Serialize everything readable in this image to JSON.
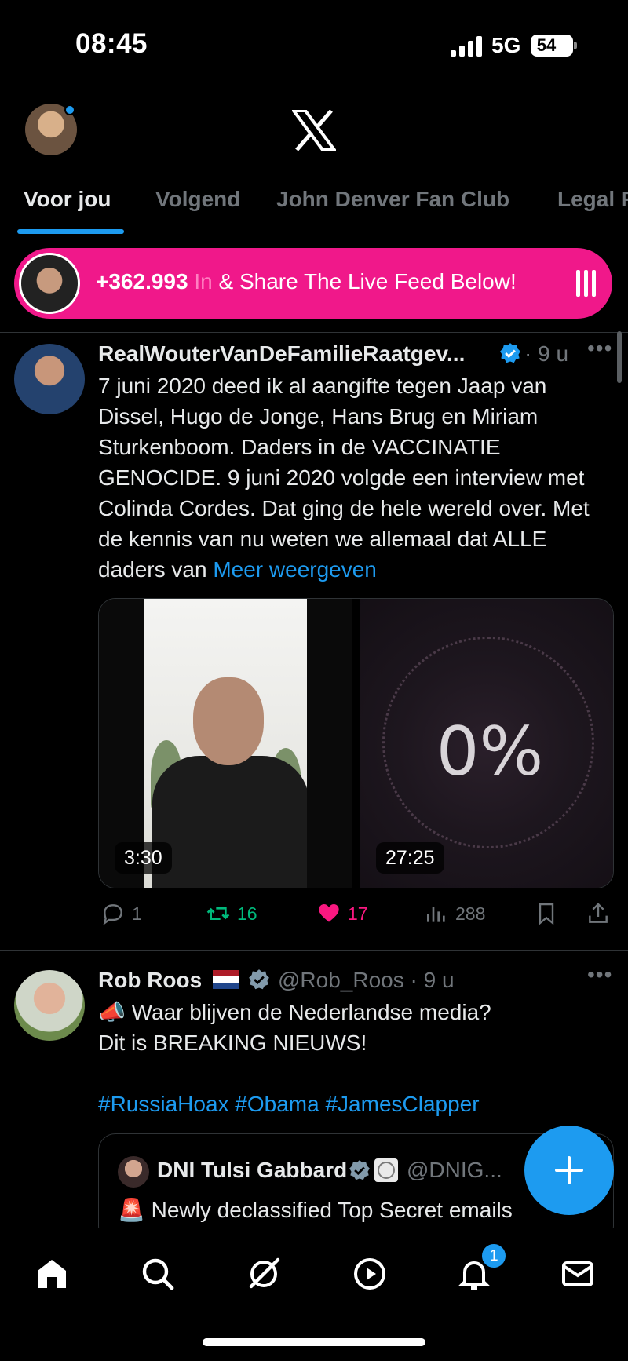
{
  "status_bar": {
    "time": "08:45",
    "network": "5G",
    "battery": "54"
  },
  "header": {
    "logo": "x-logo-icon",
    "avatar_has_notification_dot": true
  },
  "tabs": [
    {
      "label": "Voor jou",
      "active": true
    },
    {
      "label": "Volgend",
      "active": false
    },
    {
      "label": "John Denver Fan Club",
      "active": false
    },
    {
      "label": "Legal F",
      "active": false
    }
  ],
  "promo": {
    "count": "+362.993",
    "faint_prefix": "In",
    "text": "& Share The Live Feed Below!"
  },
  "tweets": [
    {
      "name": "RealWouterVanDeFamilieRaatgev...",
      "verified": true,
      "sep": "·",
      "time": "9 u",
      "body": "7 juni 2020 deed ik al aangifte tegen Jaap van Dissel, Hugo de Jonge, Hans Brug en Miriam Sturkenboom. Daders in de VACCINATIE GENOCIDE. 9 juni 2020 volgde een interview met Colinda Cordes. Dat ging de hele wereld over. Met de kennis van nu weten we allemaal dat ALLE daders van",
      "more_link": "Meer weergeven",
      "media": [
        {
          "duration": "3:30"
        },
        {
          "duration": "27:25",
          "overlay_text": "0%"
        }
      ],
      "actions": {
        "replies": "1",
        "reposts": "16",
        "likes": "17",
        "views": "288"
      }
    },
    {
      "name": "Rob Roos",
      "flag": "nl-flag-icon",
      "verified": true,
      "handle": "@Rob_Roos",
      "sep": "·",
      "time": "9 u",
      "line1": "📣 Waar blijven de Nederlandse media?",
      "line2": "Dit is BREAKING NIEUWS!",
      "hashtags": "#RussiaHoax #Obama #JamesClapper",
      "quote": {
        "name": "DNI Tulsi Gabbard",
        "handle": "@DNIG...",
        "text": "🚨 Newly declassified Top Secret emails"
      }
    }
  ],
  "bottom_nav": {
    "items": [
      "home-icon",
      "search-icon",
      "grok-icon",
      "video-icon",
      "notifications-icon",
      "messages-icon"
    ],
    "notification_badge": "1"
  },
  "colors": {
    "accent": "#1d9bf0",
    "repost": "#00ba7c",
    "like": "#f91880",
    "promo": "#f0188a"
  }
}
